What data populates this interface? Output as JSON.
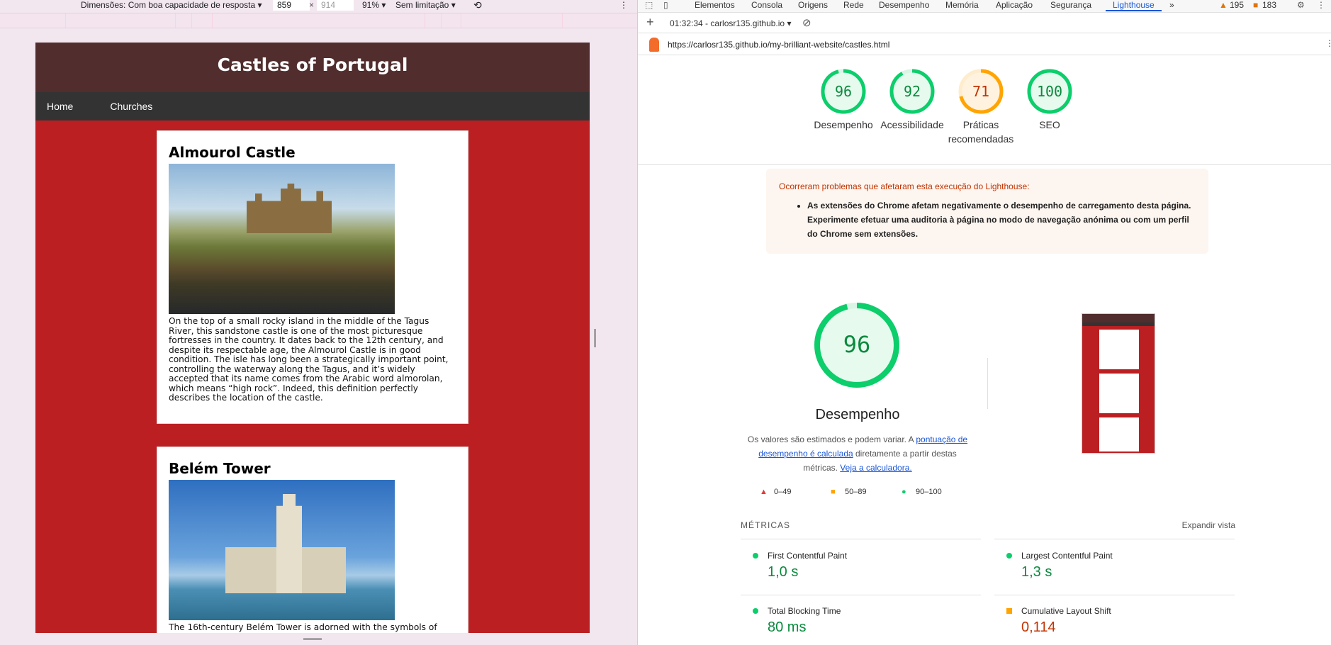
{
  "device_toolbar": {
    "dimensions_label": "Dimensões: Com boa capacidade de resposta",
    "width": "859",
    "height": "914",
    "zoom": "91%",
    "throttle": "Sem limitação"
  },
  "site": {
    "title": "Castles of Portugal",
    "nav": [
      "Home",
      "Churches"
    ],
    "cards": [
      {
        "title": "Almourol Castle",
        "text": "On the top of a small rocky island in the middle of the Tagus River, this sandstone castle is one of the most picturesque fortresses in the country. It dates back to the 12th century, and despite its respectable age, the Almourol Castle is in good condition. The isle has long been a strategically important point, controlling the waterway along the Tagus, and it’s widely accepted that its name comes from the Arabic word almorolan, which means “high rock”. Indeed, this definition perfectly describes the location of the castle."
      },
      {
        "title": "Belém Tower",
        "text": "The 16th-century Belém Tower is adorned with the symbols of"
      }
    ]
  },
  "devtools": {
    "tabs": [
      "Elementos",
      "Consola",
      "Origens",
      "Rede",
      "Desempenho",
      "Memória",
      "Aplicação",
      "Segurança",
      "Lighthouse"
    ],
    "more_tabs": "»",
    "warnings_count": "195",
    "issues_count": "183",
    "report_time": "01:32:34 - carlosr135.github.io",
    "url": "https://carlosr135.github.io/my-brilliant-website/castles.html"
  },
  "scores": [
    {
      "label": "Desempenho",
      "value": 96,
      "color": "#0cce6b"
    },
    {
      "label": "Acessibilidade",
      "value": 92,
      "color": "#0cce6b"
    },
    {
      "label": "Práticas recomendadas",
      "value": 71,
      "color": "#ffa400"
    },
    {
      "label": "SEO",
      "value": 100,
      "color": "#0cce6b"
    }
  ],
  "warning": {
    "title": "Ocorreram problemas que afetaram esta execução do Lighthouse:",
    "item": "As extensões do Chrome afetam negativamente o desempenho de carregamento desta página. Experimente efetuar uma auditoria à página no modo de navegação anónima ou com um perfil do Chrome sem extensões."
  },
  "performance": {
    "score": "96",
    "title": "Desempenho",
    "desc_pre": "Os valores são estimados e podem variar. A ",
    "link1": "pontuação de desempenho é calculada",
    "desc_mid": " diretamente a partir destas métricas. ",
    "link2": "Veja a calculadora."
  },
  "legend": [
    "0–49",
    "50–89",
    "90–100"
  ],
  "metrics_header": "MÉTRICAS",
  "expand_label": "Expandir vista",
  "metrics": [
    {
      "label": "First Contentful Paint",
      "value": "1,0 s",
      "color": "#0a8a3e"
    },
    {
      "label": "Largest Contentful Paint",
      "value": "1,3 s",
      "color": "#0a8a3e"
    },
    {
      "label": "Total Blocking Time",
      "value": "80 ms",
      "color": "#0a8a3e"
    },
    {
      "label": "Cumulative Layout Shift",
      "value": "0,114",
      "color": "#c33300"
    }
  ]
}
